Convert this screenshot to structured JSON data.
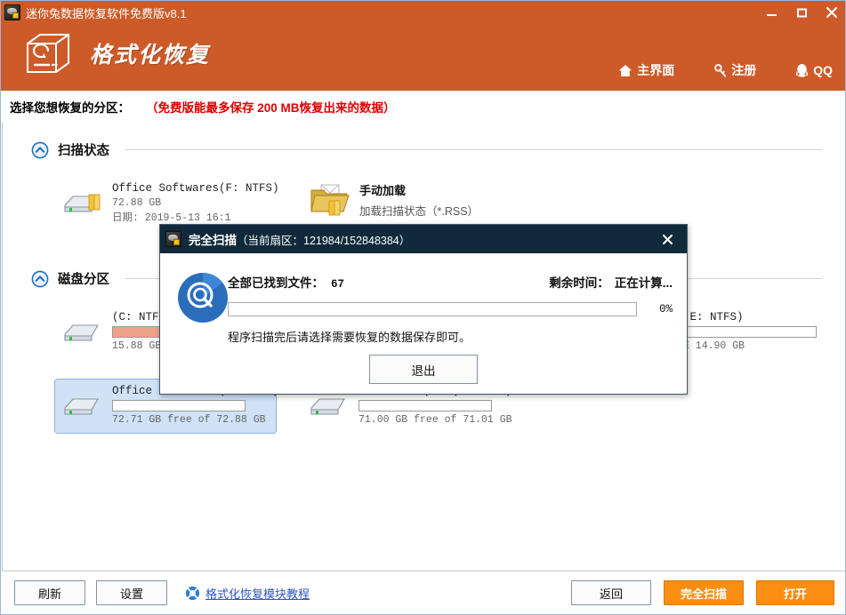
{
  "window": {
    "title": "迷你兔数据恢复软件免费版v8.1",
    "minimize": "—",
    "maximize": "□",
    "close": "✕"
  },
  "header": {
    "brand_title": "格式化恢复",
    "nav": [
      {
        "label": "主界面",
        "icon": "home-icon"
      },
      {
        "label": "注册",
        "icon": "key-icon"
      },
      {
        "label": "QQ",
        "icon": "qq-penguin-icon"
      }
    ]
  },
  "subrow": {
    "label": "选择您想恢复的分区：",
    "note": "（免费版能最多保存 200 MB恢复出来的数据）",
    "note_color": "#e00000"
  },
  "sections": {
    "scan_status": {
      "title": "扫描状态",
      "collapse_icon": "chevron-up-circle-icon"
    },
    "disk_partition": {
      "title": "磁盘分区",
      "collapse_icon": "chevron-up-circle-icon"
    }
  },
  "scan_status_items": {
    "drive": {
      "name": "Office Softwares(F: NTFS)",
      "size": "72.88 GB",
      "date": "日期: 2019-5-13 16:1"
    },
    "manual_load": {
      "title": "手动加载",
      "subtitle": "加载扫描状态（*.RSS）",
      "icon": "folder-open-icon"
    }
  },
  "partitions": [
    {
      "name": "(C: NTFS)",
      "free_text": "15.88 GB fr",
      "usage_percent": 72,
      "usage_color": "#eda289",
      "selected": false
    },
    {
      "name": "(E: NTFS)",
      "free_text": "E 14.90 GB",
      "usage_percent": 0,
      "usage_color": "#eda289",
      "selected": false
    },
    {
      "name": "Office Softwares(F: NTFS)",
      "free_text": "72.71 GB free of 72.88 GB",
      "usage_percent": 0,
      "usage_color": "#eda289",
      "selected": true
    },
    {
      "name": "Personal Space(G: NTFS)",
      "free_text": "71.00 GB free of 71.01 GB",
      "usage_percent": 0,
      "usage_color": "#eda289",
      "selected": false
    }
  ],
  "footer": {
    "refresh": "刷新",
    "settings": "设置",
    "help_link": "格式化恢复模块教程",
    "help_icon": "lifebuoy-icon",
    "back": "返回",
    "full_scan": "完全扫描",
    "open": "打开"
  },
  "modal": {
    "title": "完全扫描",
    "title_secondary": "（当前扇区：121984/152848384）",
    "close": "✕",
    "icon": "magnifier-circle-icon",
    "found_label": "全部已找到文件：",
    "found_value": "67",
    "remaining_label": "剩余时间：",
    "remaining_value": "正在计算...",
    "progress_percent": "0%",
    "progress_value": 0,
    "hint": "程序扫描完后请选择需要恢复的数据保存即可。",
    "exit_button": "退出"
  },
  "colors": {
    "brand_orange": "#cd5b29",
    "modal_navy": "#102a3c",
    "accent_button": "#f98e12",
    "link_blue": "#2a56c6",
    "selection_blue": "#cfe2f6"
  }
}
